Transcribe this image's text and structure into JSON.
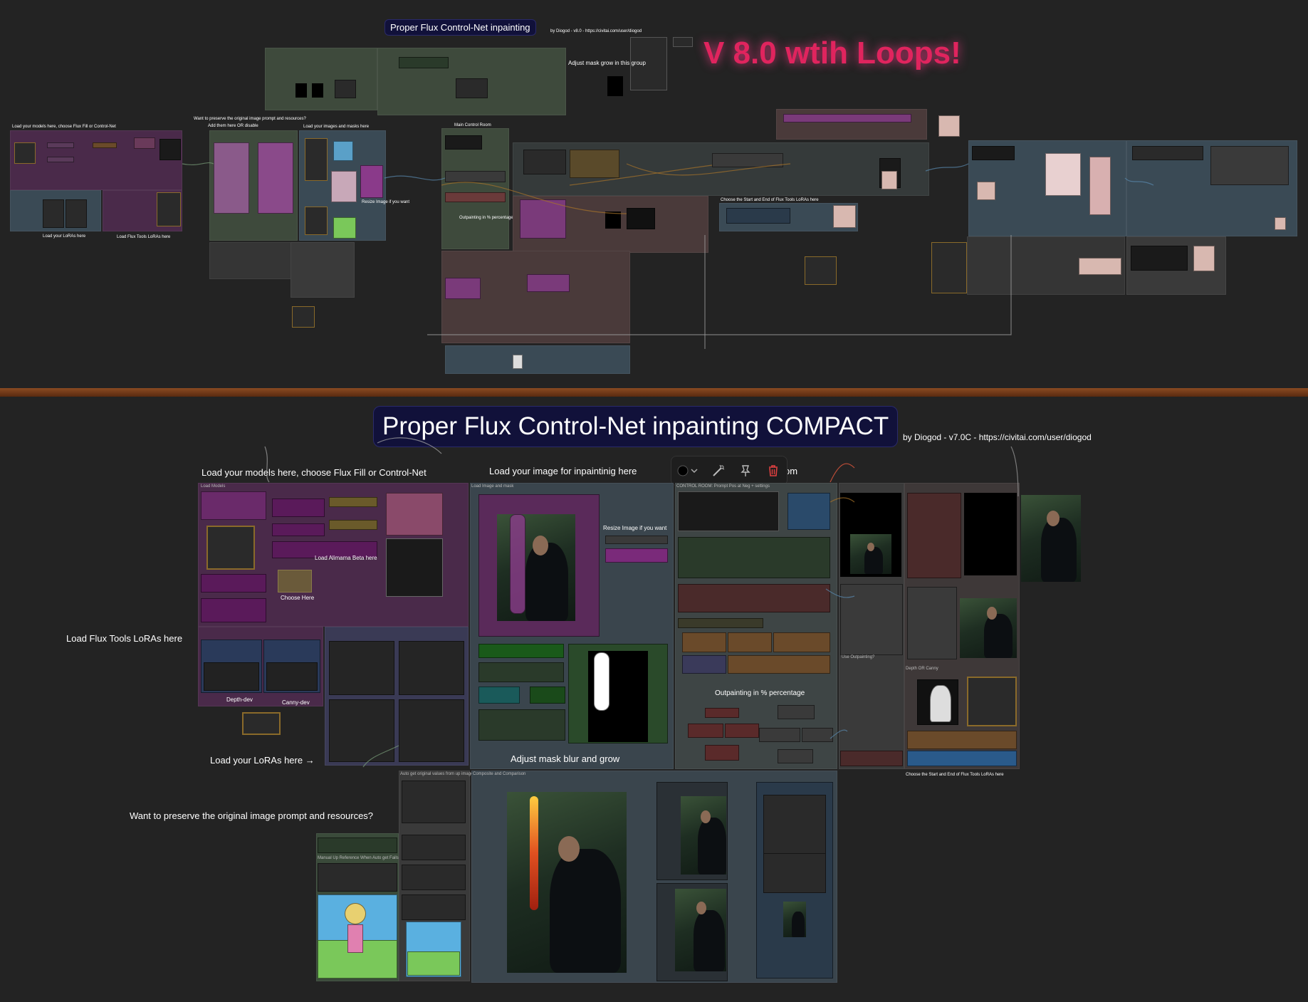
{
  "colors": {
    "background": "#232323",
    "purple_group": "#4a2a4a",
    "slate_group": "#3a4a55",
    "green_group": "#3a4a3a",
    "brown_group": "#4a3a3a",
    "title_badge": "#11113a",
    "accent_pink": "#e0245e",
    "divider": "#8a4a22"
  },
  "top": {
    "title": "Proper Flux Control-Net inpainting",
    "byline": "by Diogod - v8.0 - https://civitai.com/user/diogod",
    "version_banner": "V 8.0 wtih Loops!",
    "labels": {
      "adjust_mask": "Adjust mask grow in this group",
      "want_preserve": "Want to preserve the original image prompt and resources?",
      "add_them": "Add them here OR disable",
      "load_images": "Load your images and masks here",
      "main_control": "Main Control Room",
      "load_models": "Load your models here, choose Flux Fill or Control-Net",
      "resize": "Resize Image if you want",
      "outpainting": "Outpainting in % percentage",
      "choose_start_end": "Choose the Start and End of Flux Tools LoRAs here",
      "load_loras": "Load your LoRAs here",
      "load_flux_tools": "Load Flux Tools LoRAs here"
    }
  },
  "bottom": {
    "title": "Proper Flux Control-Net inpainting COMPACT",
    "byline": "by Diogod - v7.0C - https://civitai.com/user/diogod",
    "labels": {
      "load_models": "Load your models here, choose Flux Fill or Control-Net",
      "load_image": "Load your image for inpaintinig here",
      "room_suffix": "om",
      "resize": "Resize Image if you want",
      "load_alimama": "Load Alimama Beta here",
      "choose_here": "Choose Here",
      "load_flux_tools": "Load Flux Tools LoRAs here",
      "depth_dev": "Depth-dev",
      "canny_dev": "Canny-dev",
      "outpainting": "Outpainting in % percentage",
      "adjust_blur": "Adjust mask blur and grow",
      "load_loras": "Load your LoRAs here →",
      "choose_start_end": "Choose the Start and End of Flux Tools LoRAs here",
      "want_preserve": "Want to preserve the original image prompt and resources?"
    },
    "node_titles": {
      "load_models": "Load Models",
      "load_image_mask": "Load Image and mask",
      "control_room": "CONTROL ROOM: Prompt Pos at Neg + settings",
      "composite": "Composite and Comparison",
      "manual_ref": "Manual Up Reference When Auto get Fails",
      "auto_get": "Auto get original values from up image",
      "use_outpainting": "Use Outpainting?",
      "depth_canny": "Depth OR Canny"
    }
  },
  "toolbar": {
    "color_icon": "color-circle-icon",
    "wand_icon": "wand-icon",
    "pin_icon": "pin-icon",
    "delete_icon": "trash-icon"
  }
}
